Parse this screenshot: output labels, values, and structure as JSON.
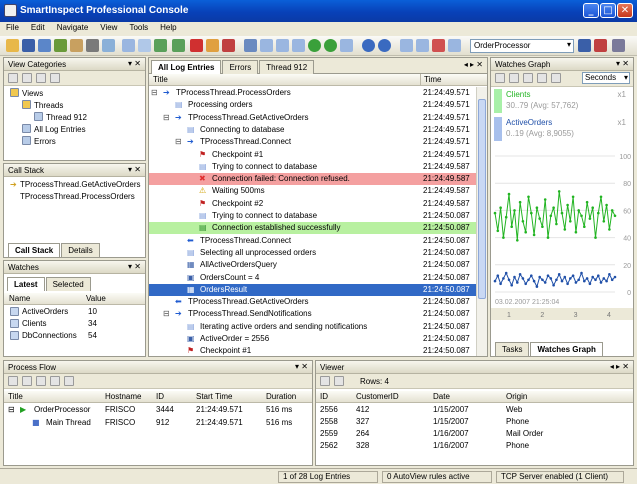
{
  "window": {
    "title": "SmartInspect Professional Console",
    "min": "_",
    "max": "□",
    "close": "✕"
  },
  "menu": [
    "File",
    "Edit",
    "Navigate",
    "View",
    "Tools",
    "Help"
  ],
  "toolbar": {
    "session_combo": "OrderProcessor"
  },
  "view_categories": {
    "title": "View Categories",
    "items": [
      {
        "label": "Views",
        "level": 0,
        "icon": "folder-icon"
      },
      {
        "label": "Threads",
        "level": 1,
        "icon": "folder-icon"
      },
      {
        "label": "Thread 912",
        "level": 2,
        "icon": "view-icon"
      },
      {
        "label": "All Log Entries",
        "level": 1,
        "icon": "view-icon"
      },
      {
        "label": "Errors",
        "level": 1,
        "icon": "view-icon"
      }
    ]
  },
  "call_stack": {
    "title": "Call Stack",
    "items": [
      "TProcessThread.GetActiveOrders",
      "TProcessThread.ProcessOrders"
    ],
    "tabs": [
      "Call Stack",
      "Details"
    ]
  },
  "watches": {
    "title": "Watches",
    "tabs": [
      "Latest",
      "Selected"
    ],
    "headers": [
      "Name",
      "Value"
    ],
    "rows": [
      {
        "name": "ActiveOrders",
        "value": "10"
      },
      {
        "name": "Clients",
        "value": "34"
      },
      {
        "name": "DbConnections",
        "value": "54"
      }
    ]
  },
  "log": {
    "tabs": [
      "All Log Entries",
      "Errors",
      "Thread 912"
    ],
    "headers": [
      "Title",
      "Time"
    ],
    "rows": [
      {
        "t": "TProcessThread.ProcessOrders",
        "time": "21:24:49.571",
        "ind": 0,
        "kind": "enter"
      },
      {
        "t": "Processing orders",
        "time": "21:24:49.571",
        "ind": 1,
        "kind": "msg"
      },
      {
        "t": "TProcessThread.GetActiveOrders",
        "time": "21:24:49.571",
        "ind": 1,
        "kind": "enter"
      },
      {
        "t": "Connecting to database",
        "time": "21:24:49.571",
        "ind": 2,
        "kind": "msg"
      },
      {
        "t": "TProcessThread.Connect",
        "time": "21:24:49.571",
        "ind": 2,
        "kind": "enter"
      },
      {
        "t": "Checkpoint #1",
        "time": "21:24:49.571",
        "ind": 3,
        "kind": "flag"
      },
      {
        "t": "Trying to connect to database",
        "time": "21:24:49.587",
        "ind": 3,
        "kind": "msg"
      },
      {
        "t": "Connection failed: Connection refused.",
        "time": "21:24:49.587",
        "ind": 3,
        "kind": "error"
      },
      {
        "t": "Waiting 500ms",
        "time": "21:24:49.587",
        "ind": 3,
        "kind": "warn"
      },
      {
        "t": "Checkpoint #2",
        "time": "21:24:49.587",
        "ind": 3,
        "kind": "flag"
      },
      {
        "t": "Trying to connect to database",
        "time": "21:24:50.087",
        "ind": 3,
        "kind": "msg"
      },
      {
        "t": "Connection established successfully",
        "time": "21:24:50.087",
        "ind": 3,
        "kind": "success"
      },
      {
        "t": "TProcessThread.Connect",
        "time": "21:24:50.087",
        "ind": 2,
        "kind": "leave"
      },
      {
        "t": "Selecting all unprocessed orders",
        "time": "21:24:50.087",
        "ind": 2,
        "kind": "msg"
      },
      {
        "t": "AllActiveOrdersQuery",
        "time": "21:24:50.087",
        "ind": 2,
        "kind": "data"
      },
      {
        "t": "OrdersCount = 4",
        "time": "21:24:50.087",
        "ind": 2,
        "kind": "var"
      },
      {
        "t": "OrdersResult",
        "time": "21:24:50.087",
        "ind": 2,
        "kind": "selected"
      },
      {
        "t": "TProcessThread.GetActiveOrders",
        "time": "21:24:50.087",
        "ind": 1,
        "kind": "leave"
      },
      {
        "t": "TProcessThread.SendNotifications",
        "time": "21:24:50.087",
        "ind": 1,
        "kind": "enter"
      },
      {
        "t": "Iterating active orders and sending notifications",
        "time": "21:24:50.087",
        "ind": 2,
        "kind": "msg"
      },
      {
        "t": "ActiveOrder = 2556",
        "time": "21:24:50.087",
        "ind": 2,
        "kind": "var"
      },
      {
        "t": "Checkpoint #1",
        "time": "21:24:50.087",
        "ind": 2,
        "kind": "flag"
      }
    ]
  },
  "graph": {
    "title": "Watches Graph",
    "combo": "Seconds",
    "series": [
      {
        "name": "Clients",
        "stats": "30..79 (Avg: 57,762)",
        "scale": "x1",
        "color": "#22b422"
      },
      {
        "name": "ActiveOrders",
        "stats": "0..19 (Avg: 8,9055)",
        "scale": "x1",
        "color": "#1f4fa8"
      }
    ],
    "yticks": [
      "100",
      "80",
      "60",
      "40",
      "20",
      "0"
    ],
    "xticks": [
      "1",
      "2",
      "3",
      "4"
    ],
    "timestamp": "03.02.2007 21:25:04",
    "clients": [
      58,
      45,
      62,
      40,
      55,
      72,
      48,
      60,
      38,
      66,
      52,
      44,
      70,
      58,
      42,
      62,
      54,
      48,
      68,
      40,
      56,
      62,
      50,
      74,
      58,
      46,
      64,
      52,
      70,
      44,
      60,
      56,
      48,
      66,
      54,
      62,
      40,
      58,
      70,
      52,
      64,
      46,
      60,
      56
    ],
    "orders": [
      8,
      12,
      6,
      10,
      14,
      9,
      5,
      11,
      7,
      13,
      10,
      6,
      9,
      12,
      8,
      4,
      11,
      9,
      7,
      12,
      10,
      5,
      9,
      13,
      8,
      11,
      6,
      10,
      12,
      7,
      9,
      14,
      8,
      10,
      6,
      11,
      9,
      12,
      7,
      10,
      8,
      13,
      9,
      11
    ],
    "tabs": [
      "Tasks",
      "Watches Graph"
    ]
  },
  "process_flow": {
    "title": "Process Flow",
    "headers": [
      "Title",
      "Hostname",
      "ID",
      "Start Time",
      "Duration"
    ],
    "rows": [
      {
        "title": "OrderProcessor",
        "host": "FRISCO",
        "id": "3444",
        "start": "21:24:49.571",
        "dur": "516 ms"
      },
      {
        "title": "Main Thread",
        "host": "FRISCO",
        "id": "912",
        "start": "21:24:49.571",
        "dur": "516 ms"
      }
    ]
  },
  "viewer": {
    "title": "Viewer",
    "rows_label": "Rows: 4",
    "headers": [
      "ID",
      "CustomerID",
      "Date",
      "Origin"
    ],
    "rows": [
      {
        "id": "2556",
        "cid": "412",
        "date": "1/15/2007",
        "origin": "Web"
      },
      {
        "id": "2558",
        "cid": "327",
        "date": "1/15/2007",
        "origin": "Phone"
      },
      {
        "id": "2559",
        "cid": "264",
        "date": "1/16/2007",
        "origin": "Mail Order"
      },
      {
        "id": "2562",
        "cid": "328",
        "date": "1/16/2007",
        "origin": "Phone"
      }
    ]
  },
  "status": {
    "entries": "1 of 28 Log Entries",
    "autoview": "0 AutoView rules active",
    "tcp": "TCP Server enabled (1 Client)"
  }
}
